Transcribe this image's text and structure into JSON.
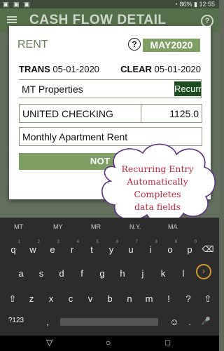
{
  "status_bar": {
    "left_icons": "▣ ▣ ▣",
    "battery": "86%",
    "time": "12:55"
  },
  "app_bar": {
    "title": "CASH FLOW DETAIL"
  },
  "dialog": {
    "title": "RENT",
    "month": "MAY2020",
    "trans_label": "TRANS",
    "trans_date": "05-01-2020",
    "clear_label": "CLEAR",
    "clear_date": "05-01-2020",
    "payee": "MT Properties",
    "recurring_button": "Recurring",
    "account": "UNITED CHECKING",
    "amount": "1125.0",
    "memo": "Monthly Apartment Rent",
    "tax_button": "NOT TAX"
  },
  "callout": {
    "text": [
      "Recurring Entry",
      "Automatically",
      "Completes",
      "data fields"
    ]
  },
  "keyboard": {
    "suggestions": [
      "MT",
      "MY",
      "MR",
      "N.Y.",
      "MA"
    ],
    "row1": [
      "q",
      "w",
      "e",
      "r",
      "t",
      "y",
      "u",
      "i",
      "o",
      "p"
    ],
    "row1_numbers": [
      "1",
      "2",
      "3",
      "4",
      "5",
      "6",
      "7",
      "8",
      "9",
      "0"
    ],
    "row2": [
      "a",
      "s",
      "d",
      "f",
      "g",
      "h",
      "j",
      "k",
      "l"
    ],
    "row3": [
      "z",
      "x",
      "c",
      "v",
      "b",
      "n",
      "m",
      "!",
      "?"
    ],
    "row4": {
      "sym": "?123",
      "comma": ",",
      "emoji": "☺",
      "period": ".",
      "mic": "🎤"
    }
  },
  "nav": {
    "back": "▽",
    "home": "○",
    "recents": "□"
  },
  "colors": {
    "accent_green": "#7e9e63",
    "recur_green": "#1a4d1f",
    "callout_red": "#c0283d"
  }
}
